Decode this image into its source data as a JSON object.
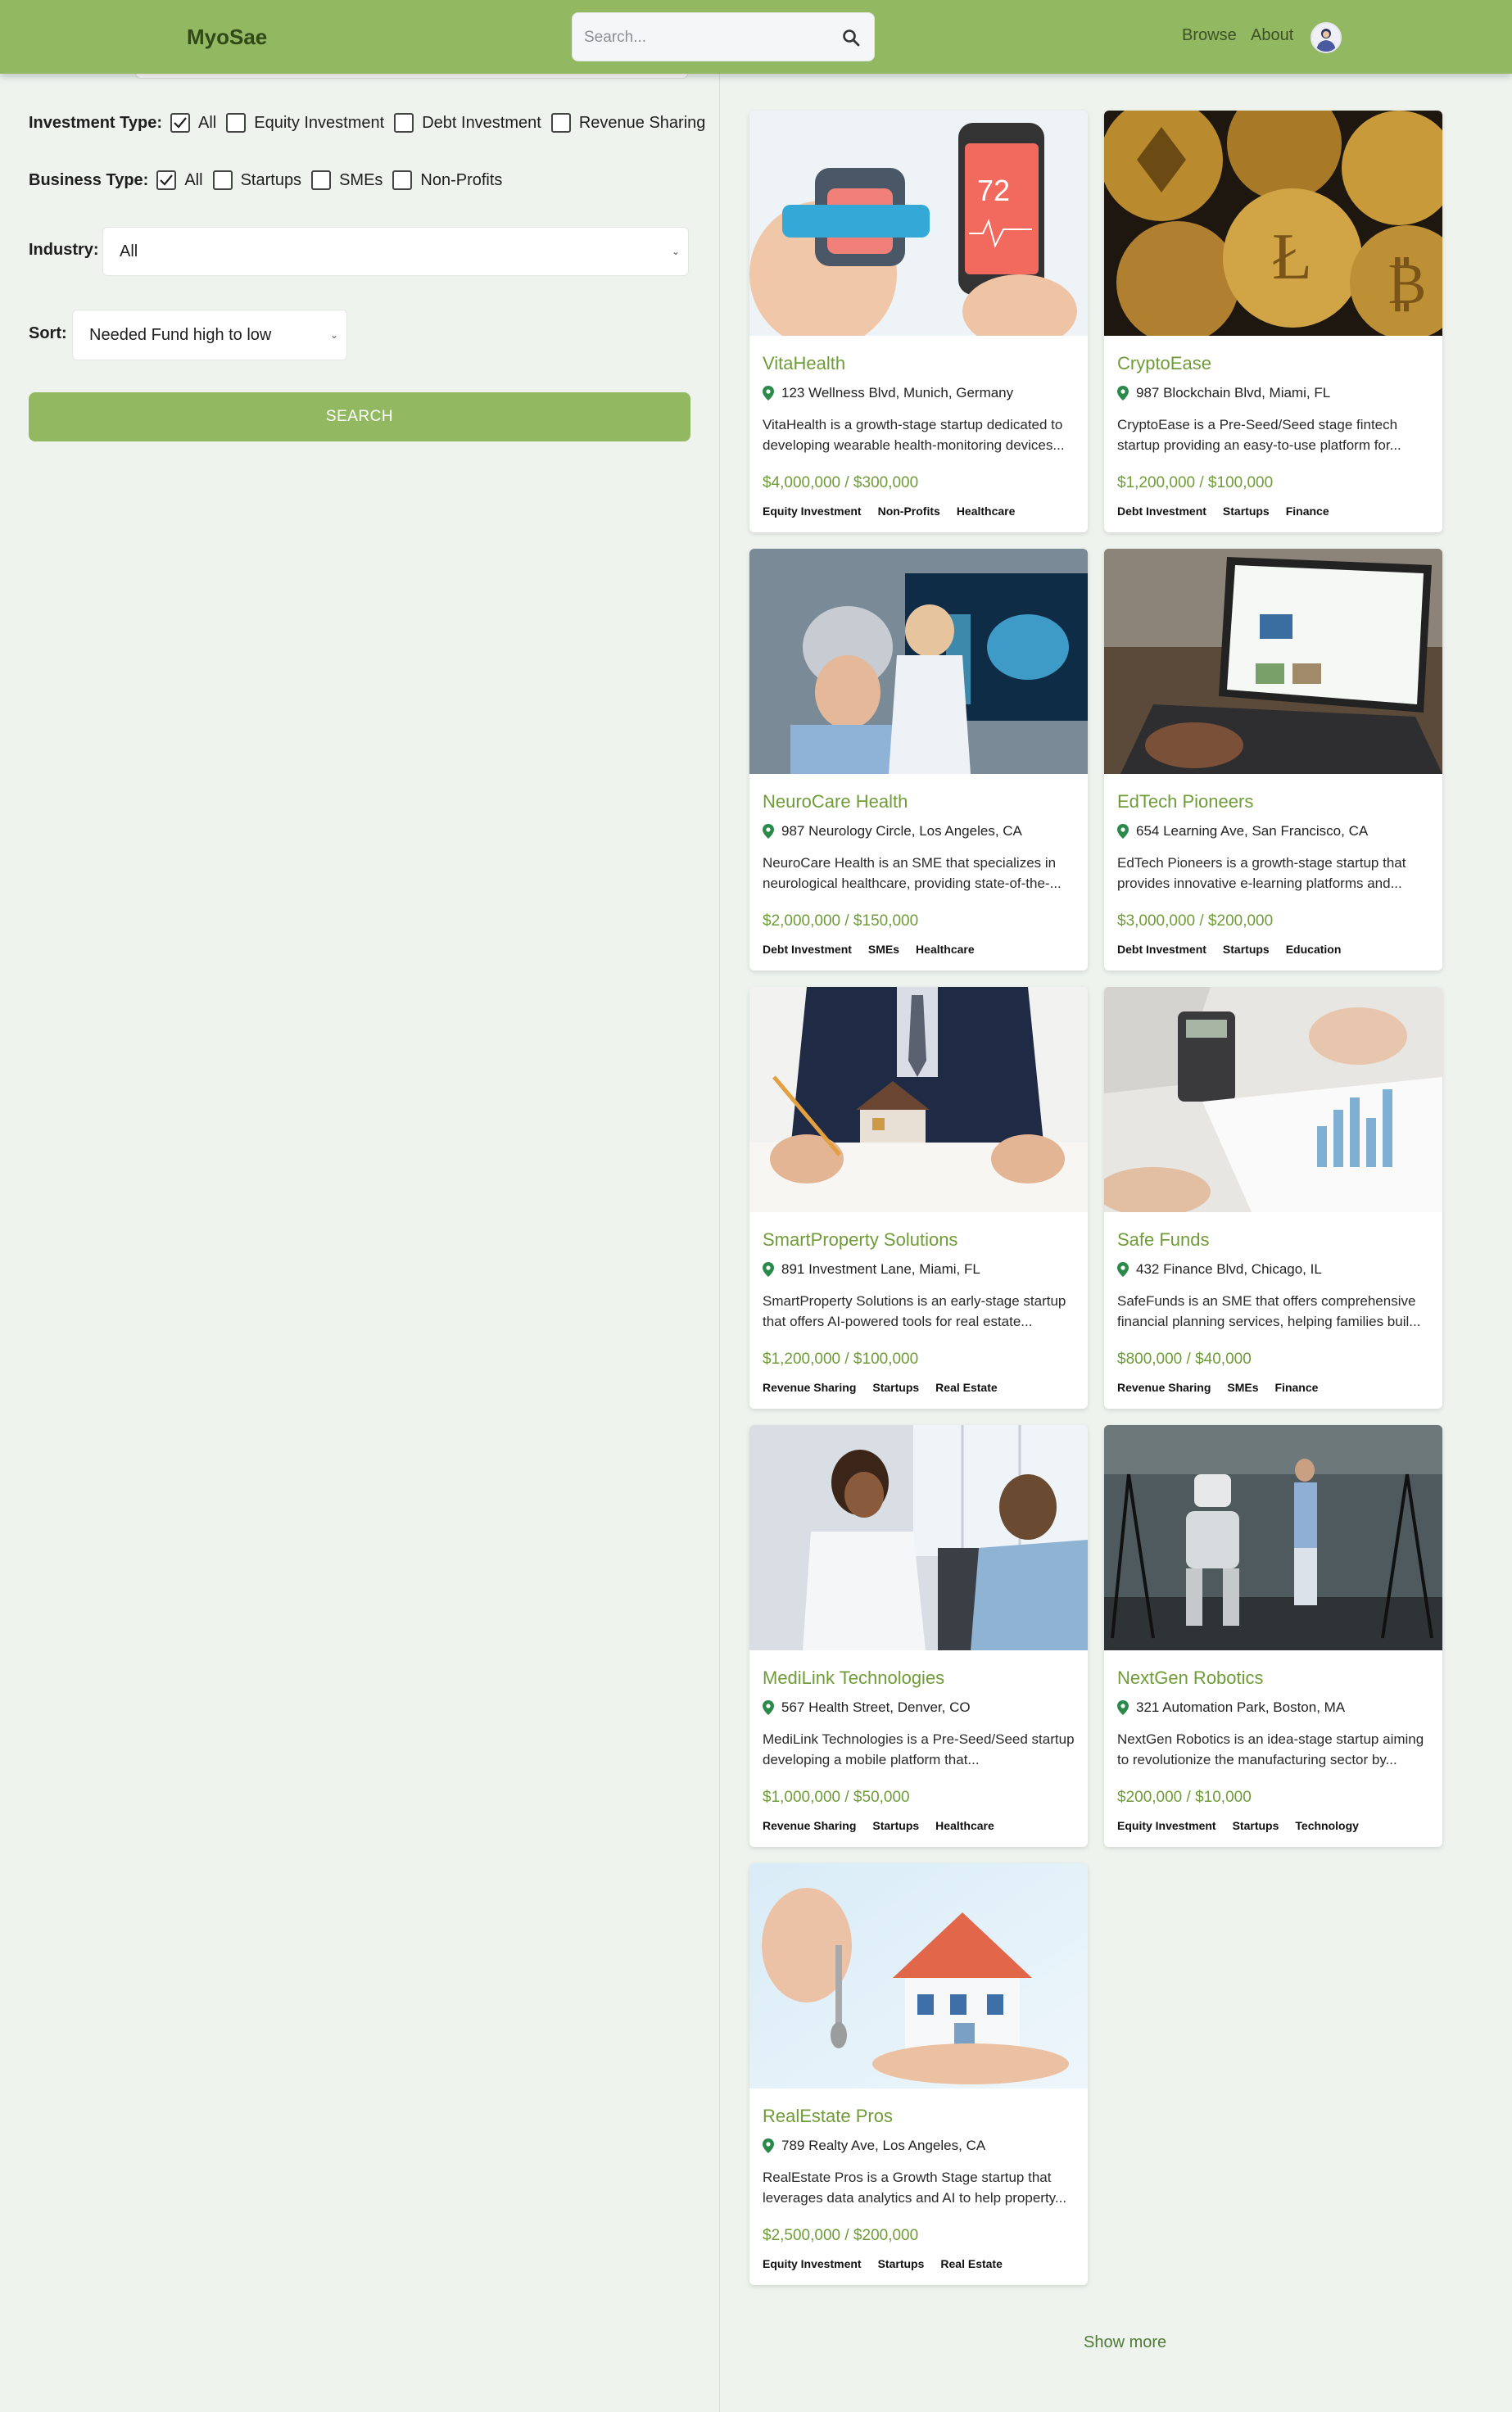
{
  "header": {
    "logo": "MyoSae",
    "search_placeholder": "Search...",
    "nav": [
      "Browse",
      "About"
    ]
  },
  "filters": {
    "investment_type_label": "Investment Type:",
    "investment_options": [
      "All",
      "Equity Investment",
      "Debt Investment",
      "Revenue Sharing"
    ],
    "investment_checked": "All",
    "business_type_label": "Business Type:",
    "business_options": [
      "All",
      "Startups",
      "SMEs",
      "Non-Profits"
    ],
    "business_checked": "All",
    "industry_label": "Industry:",
    "industry_value": "All",
    "sort_label": "Sort:",
    "sort_value": "Needed Fund high to low",
    "search_button": "SEARCH"
  },
  "listings": [
    {
      "title": "VitaHealth",
      "location": "123 Wellness Blvd, Munich, Germany",
      "description": "VitaHealth is a growth-stage startup dedicated to developing wearable health-monitoring devices...",
      "funds": "$4,000,000 / $300,000",
      "tags": [
        "Equity Investment",
        "Non-Profits",
        "Healthcare"
      ]
    },
    {
      "title": "CryptoEase",
      "location": "987 Blockchain Blvd, Miami, FL",
      "description": "CryptoEase is a Pre-Seed/Seed stage fintech startup providing an easy-to-use platform for...",
      "funds": "$1,200,000 / $100,000",
      "tags": [
        "Debt Investment",
        "Startups",
        "Finance"
      ]
    },
    {
      "title": "NeuroCare Health",
      "location": "987 Neurology Circle, Los Angeles, CA",
      "description": "NeuroCare Health is an SME that specializes in neurological healthcare, providing state-of-the-...",
      "funds": "$2,000,000 / $150,000",
      "tags": [
        "Debt Investment",
        "SMEs",
        "Healthcare"
      ]
    },
    {
      "title": "EdTech Pioneers",
      "location": "654 Learning Ave, San Francisco, CA",
      "description": "EdTech Pioneers is a growth-stage startup that provides innovative e-learning platforms and...",
      "funds": "$3,000,000 / $200,000",
      "tags": [
        "Debt Investment",
        "Startups",
        "Education"
      ]
    },
    {
      "title": "SmartProperty Solutions",
      "location": "891 Investment Lane, Miami, FL",
      "description": "SmartProperty Solutions is an early-stage startup that offers AI-powered tools for real estate...",
      "funds": "$1,200,000 / $100,000",
      "tags": [
        "Revenue Sharing",
        "Startups",
        "Real Estate"
      ]
    },
    {
      "title": "Safe Funds",
      "location": "432 Finance Blvd, Chicago, IL",
      "description": "SafeFunds is an SME that offers comprehensive financial planning services, helping families buil...",
      "funds": "$800,000 / $40,000",
      "tags": [
        "Revenue Sharing",
        "SMEs",
        "Finance"
      ]
    },
    {
      "title": "MediLink Technologies",
      "location": "567 Health Street, Denver, CO",
      "description": "MediLink Technologies is a Pre-Seed/Seed startup developing a mobile platform that...",
      "funds": "$1,000,000 / $50,000",
      "tags": [
        "Revenue Sharing",
        "Startups",
        "Healthcare"
      ]
    },
    {
      "title": "NextGen Robotics",
      "location": "321 Automation Park, Boston, MA",
      "description": "NextGen Robotics is an idea-stage startup aiming to revolutionize the manufacturing sector by...",
      "funds": "$200,000 / $10,000",
      "tags": [
        "Equity Investment",
        "Startups",
        "Technology"
      ]
    },
    {
      "title": "RealEstate Pros",
      "location": "789 Realty Ave, Los Angeles, CA",
      "description": "RealEstate Pros is a Growth Stage startup that leverages data analytics and AI to help property...",
      "funds": "$2,500,000 / $200,000",
      "tags": [
        "Equity Investment",
        "Startups",
        "Real Estate"
      ]
    }
  ],
  "show_more": "Show more",
  "colors": {
    "brand": "#93b862",
    "accent_text": "#6f9c39",
    "background": "#eef3ee"
  },
  "icons": [
    "search-icon",
    "avatar-icon",
    "location-pin-icon",
    "checkmark-icon",
    "chevron-down-icon"
  ]
}
